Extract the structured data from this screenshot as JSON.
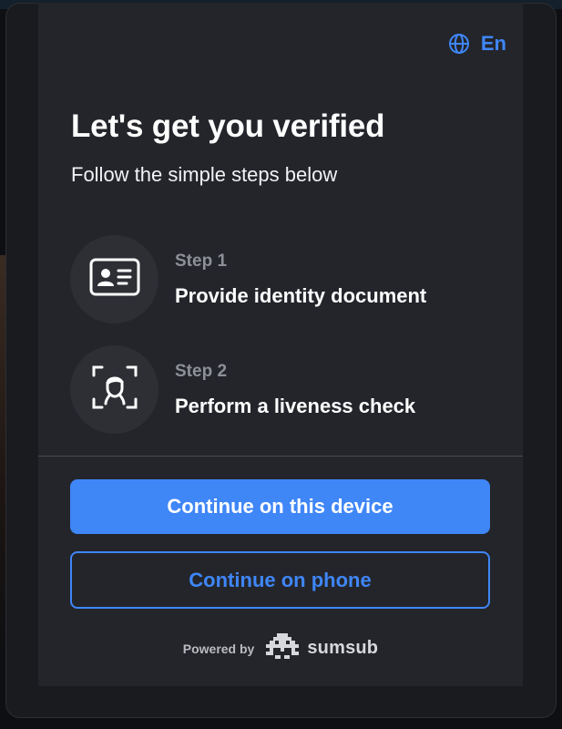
{
  "header": {
    "language_label": "En",
    "language_icon": "globe-icon",
    "accent_color": "#3f86f7"
  },
  "main": {
    "title": "Let's get you verified",
    "subtitle": "Follow the simple steps below",
    "steps": [
      {
        "number_label": "Step 1",
        "label": "Provide identity document",
        "icon": "id-card-icon"
      },
      {
        "number_label": "Step 2",
        "label": "Perform a liveness check",
        "icon": "face-scan-icon"
      }
    ]
  },
  "actions": {
    "primary_label": "Continue on this device",
    "secondary_label": "Continue on phone"
  },
  "footer": {
    "powered_by": "Powered by",
    "brand_name": "sumsub",
    "brand_icon": "sumsub-logo"
  }
}
